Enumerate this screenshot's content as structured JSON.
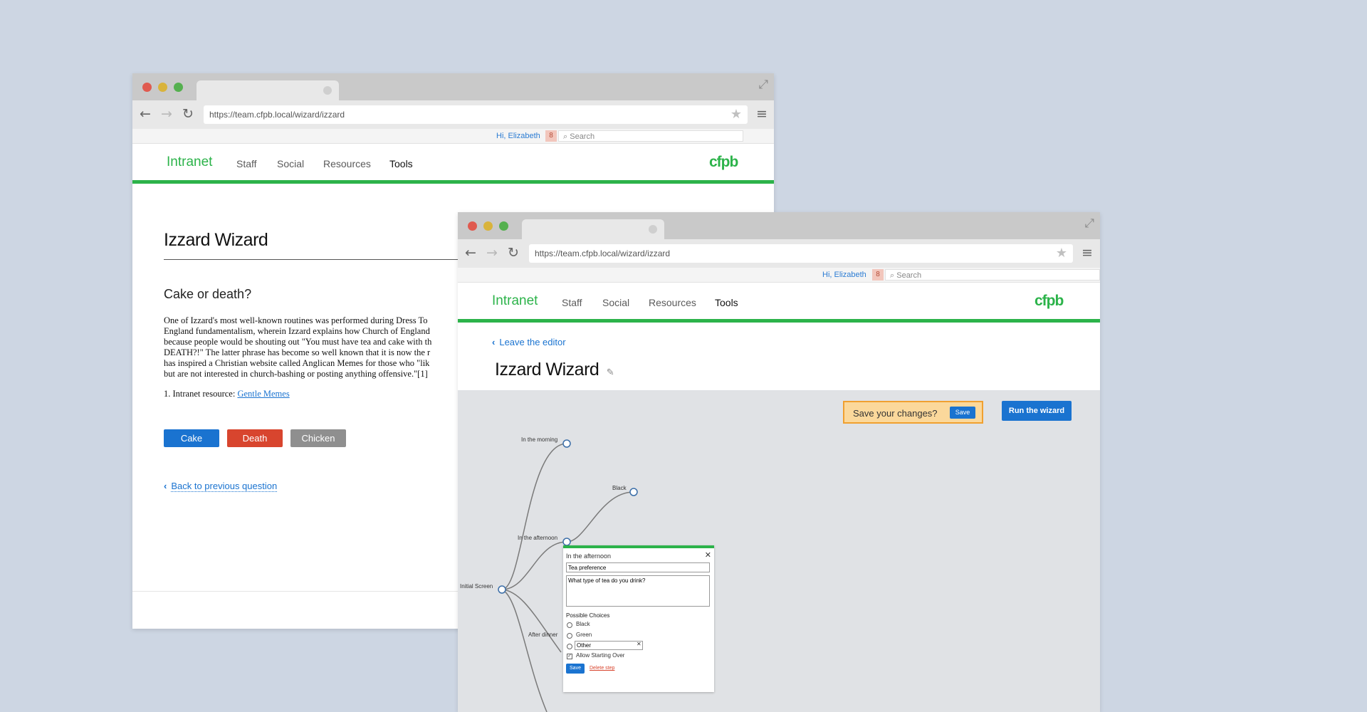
{
  "back_window": {
    "url": "https://team.cfpb.local/wizard/izzard",
    "utility": {
      "greeting": "Hi, Elizabeth",
      "notification_count": "8",
      "search_placeholder": "Search"
    },
    "nav": {
      "brand": "Intranet",
      "links": [
        "Staff",
        "Social",
        "Resources",
        "Tools"
      ],
      "logo": "cfpb"
    },
    "page_title": "Izzard Wizard",
    "question": "Cake or death?",
    "body_lines": [
      "One of Izzard's most well-known routines was performed during Dress To",
      "England fundamentalism, wherein Izzard explains how Church of England",
      "because people would be shouting out \"You must have tea and cake with th",
      "DEATH?!\" The latter phrase has become so well known that it is now the r",
      "has inspired a Christian website called Anglican Memes for those who \"lik",
      "but are not interested in church-bashing or posting anything offensive.\"[1]"
    ],
    "resource_prefix": "1. Intranet resource: ",
    "resource_link": "Gentle Memes",
    "buttons": {
      "cake": "Cake",
      "death": "Death",
      "chicken": "Chicken"
    },
    "back_link": "Back to previous question",
    "colors": {
      "cake": "#1a73d0",
      "death": "#d8452e",
      "chicken": "#8f8f8f"
    }
  },
  "front_window": {
    "url": "https://team.cfpb.local/wizard/izzard",
    "utility": {
      "greeting": "Hi, Elizabeth",
      "notification_count": "8",
      "search_placeholder": "Search"
    },
    "nav": {
      "brand": "Intranet",
      "links": [
        "Staff",
        "Social",
        "Resources",
        "Tools"
      ],
      "logo": "cfpb"
    },
    "leave_link": "Leave the editor",
    "page_title": "Izzard Wizard",
    "save_prompt": "Save your changes?",
    "save_button": "Save",
    "run_button": "Run the wizard",
    "tree_nodes": {
      "initial": "Initial Screen",
      "morning": "In the morning",
      "afternoon": "In the afternoon",
      "black": "Black",
      "after_dinner": "After dinner"
    },
    "popup": {
      "heading": "In the afternoon",
      "title_value": "Tea preference",
      "question_value": "What type of tea do you drink?",
      "choices_label": "Possible Choices",
      "choices": [
        "Black",
        "Green"
      ],
      "other_value": "Other",
      "allow_restart": "Allow Starting Over",
      "save": "Save",
      "delete": "Delete step"
    },
    "colors": {
      "accent_green": "#2cb34a",
      "primary_blue": "#1a73d0",
      "save_prompt_bg": "#fbd89b",
      "delete_red": "#d8452e"
    }
  }
}
